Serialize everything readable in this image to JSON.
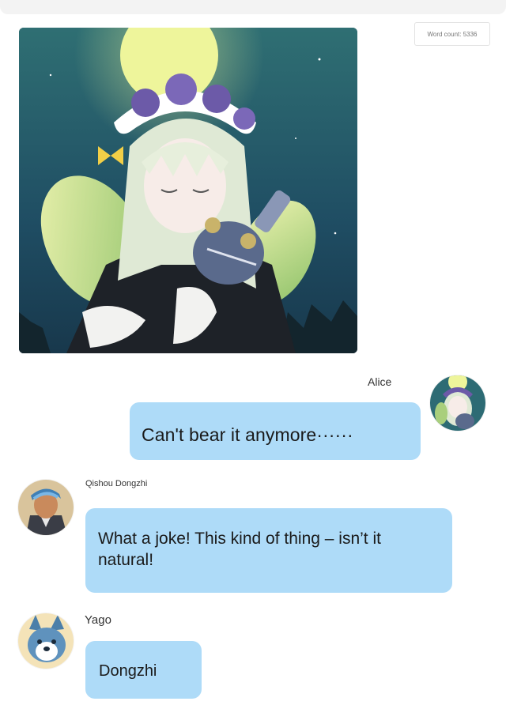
{
  "header": {
    "word_count_label": "Word count: 5336"
  },
  "messages": [
    {
      "sender": "Alice",
      "side": "right",
      "text": "Can't bear it anymore······",
      "avatar_icon": "alice-avatar-icon"
    },
    {
      "sender": "Qishou Dongzhi",
      "side": "left",
      "text": "What a joke! This kind of thing – isn’t it natural!",
      "avatar_icon": "dongzhi-avatar-icon"
    },
    {
      "sender": "Yago",
      "side": "left",
      "text": "Dongzhi",
      "avatar_icon": "yago-avatar-icon"
    }
  ],
  "shared_image": {
    "icon": "anime-girl-illustration"
  },
  "colors": {
    "bubble": "#aedbf8",
    "background": "#ffffff"
  }
}
